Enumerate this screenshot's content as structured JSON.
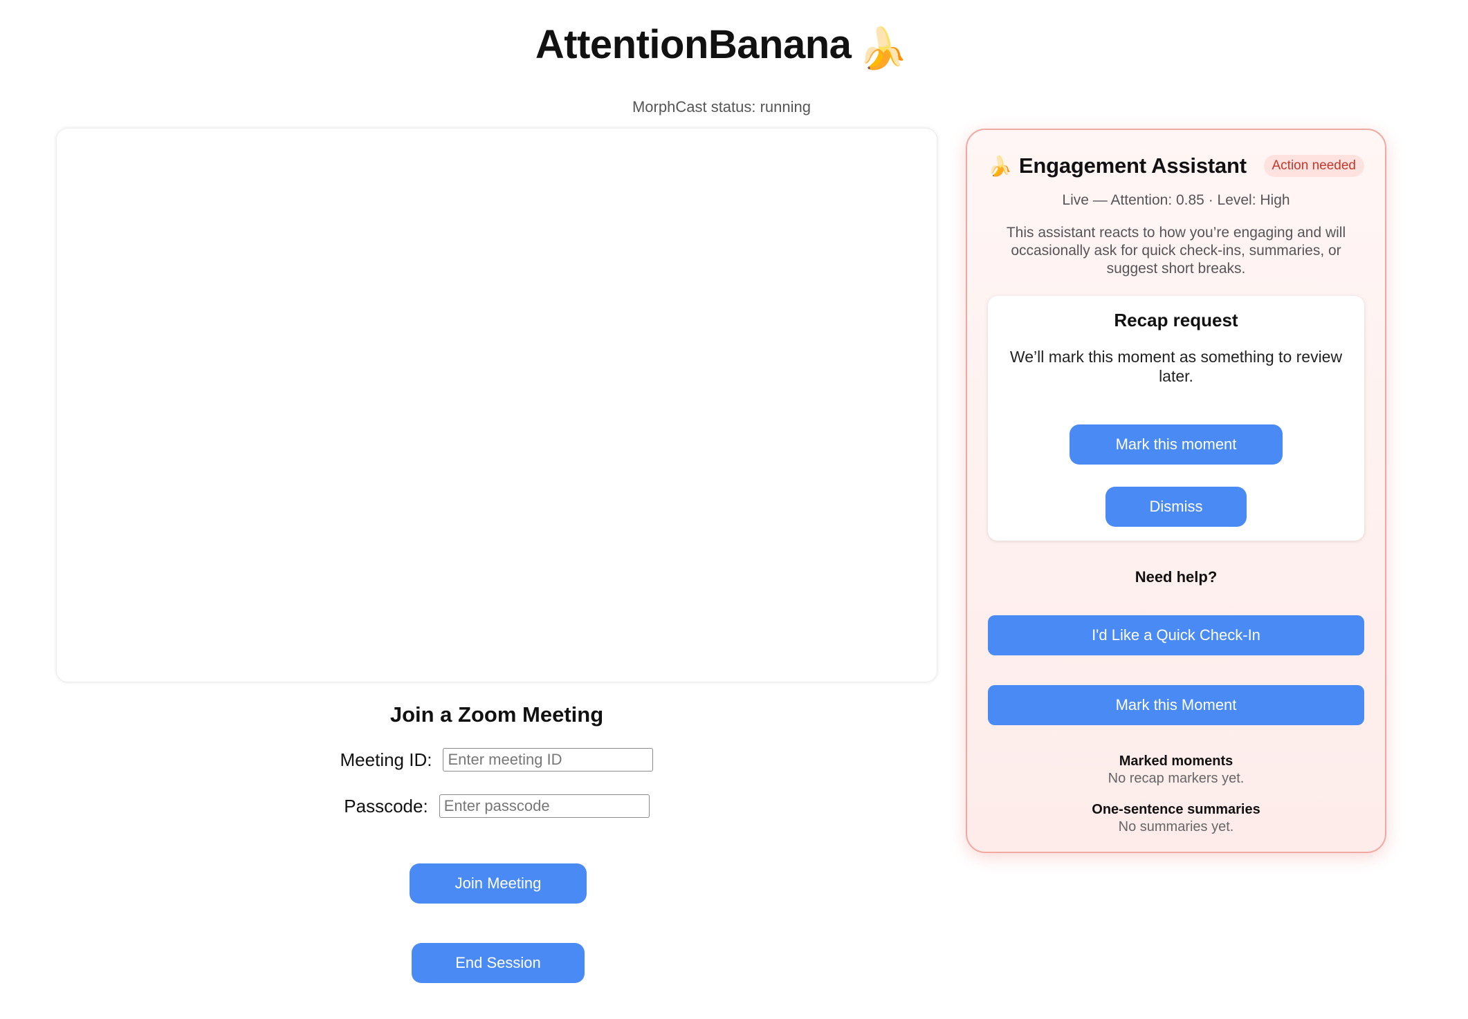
{
  "app": {
    "title": "AttentionBanana",
    "title_emoji": "🍌",
    "status": "MorphCast status: running"
  },
  "join": {
    "title": "Join a Zoom Meeting",
    "meeting_id_label": "Meeting ID:",
    "meeting_id_placeholder": "Enter meeting ID",
    "meeting_id_value": "",
    "passcode_label": "Passcode:",
    "passcode_placeholder": "Enter passcode",
    "passcode_value": "",
    "join_button": "Join Meeting",
    "end_button": "End Session"
  },
  "assistant": {
    "icon": "🍌",
    "title": "Engagement Assistant",
    "badge": "Action needed",
    "live_status": "Live — Attention: 0.85 · Level: High",
    "description": "This assistant reacts to how you’re engaging and will occasionally ask for quick check-ins, summaries, or suggest short breaks.",
    "recap": {
      "title": "Recap request",
      "body": "We’ll mark this moment as something to review later.",
      "mark_button": "Mark this moment",
      "dismiss_button": "Dismiss"
    },
    "help_title": "Need help?",
    "checkin_button": "I'd Like a Quick Check-In",
    "mark_button": "Mark this Moment",
    "marked_moments": {
      "title": "Marked moments",
      "empty": "No recap markers yet."
    },
    "summaries": {
      "title": "One-sentence summaries",
      "empty": "No summaries yet."
    }
  },
  "colors": {
    "accent": "#4a8af4",
    "panel_border": "#f1a8a0",
    "badge_text": "#c0392b",
    "badge_bg": "#fde2df"
  }
}
